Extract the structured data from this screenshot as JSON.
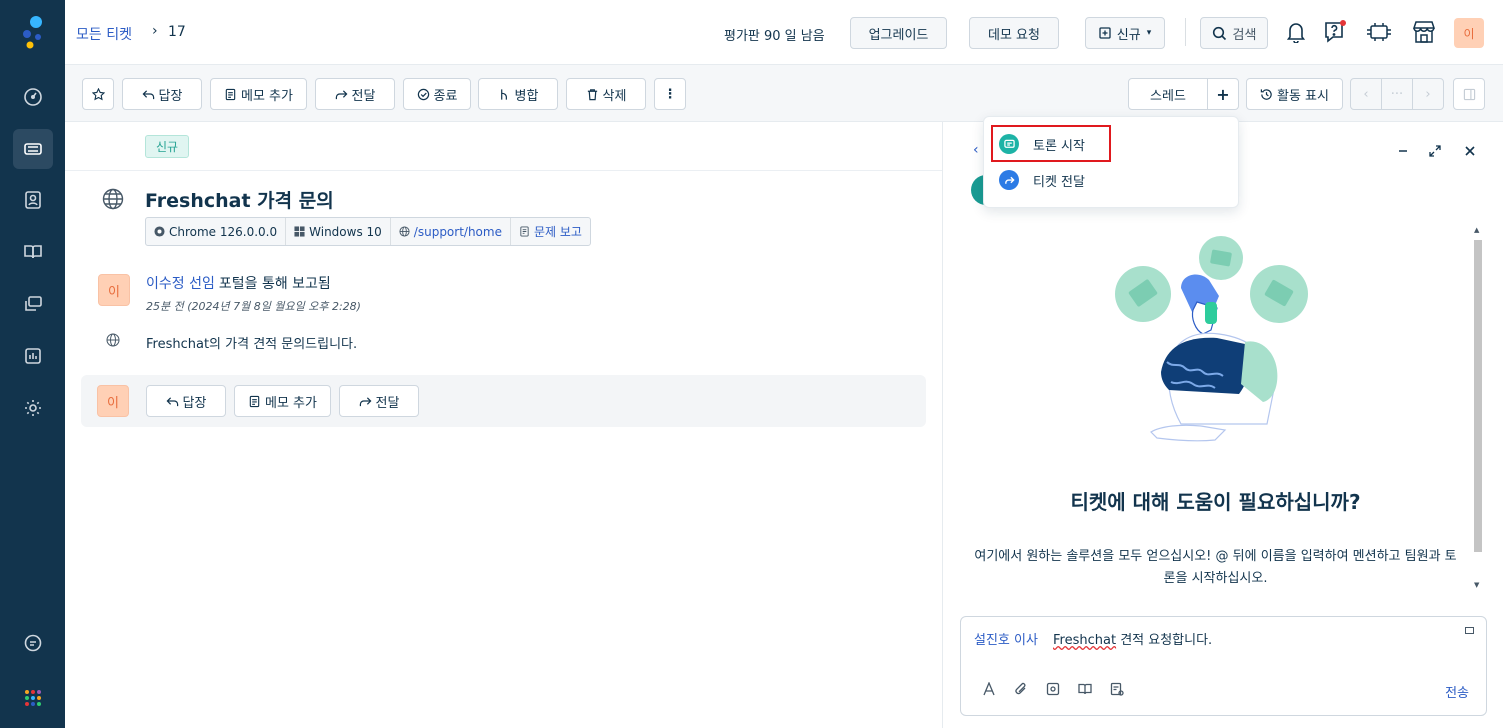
{
  "topbar": {
    "breadcrumb_link": "모든 티켓",
    "breadcrumb_sep": "›",
    "breadcrumb_count": "17",
    "trial_text": "평가판 90 일 남음",
    "upgrade_label": "업그레이드",
    "demo_label": "데모 요청",
    "new_label": "신규",
    "search_label": "검색",
    "avatar_initial": "이"
  },
  "actions": {
    "reply": "답장",
    "add_note": "메모 추가",
    "forward": "전달",
    "close": "종료",
    "merge": "병합",
    "delete": "삭제",
    "more": "⋮",
    "thread": "스레드",
    "plus": "+",
    "show_activity": "활동 표시",
    "nav_dots": "···"
  },
  "ticket": {
    "status": "신규",
    "title": "Freshchat 가격 문의",
    "browser": "Chrome 126.0.0.0",
    "os": "Windows 10",
    "url": "/support/home",
    "report": "문제 보고",
    "author_initial": "이",
    "author_name": "이수정 선임",
    "author_via": "포털을 통해 보고됨",
    "timestamp": "25분 전 (2024년 7월 8일 월요일 오후 2:28)",
    "message": "Freshchat의 가격 견적 문의드립니다."
  },
  "reply_bar": {
    "initial": "이",
    "reply": "답장",
    "add_note": "메모 추가",
    "forward": "전달"
  },
  "dropdown": {
    "items": [
      {
        "label": "토론 시작",
        "icon": "discussion-icon",
        "color": "#1db3a6"
      },
      {
        "label": "티켓 전달",
        "icon": "forward-icon",
        "color": "#2c7be5"
      }
    ]
  },
  "panel": {
    "back": "‹",
    "help_title": "티켓에 대해 도움이 필요하십니까?",
    "help_desc": "여기에서 원하는 솔루션을 모두 얻으십시오! @ 뒤에 이름을 입력하여 멘션하고 팀원과 토론을 시작하십시오.",
    "mention": "설진호 이사",
    "composer_word": "Freshchat",
    "composer_rest": " 견적 요청합니다.",
    "send": "전송"
  },
  "colors": {
    "sidebar": "#12344d",
    "accent": "#2c5cc5",
    "highlight": "#e0191e"
  }
}
